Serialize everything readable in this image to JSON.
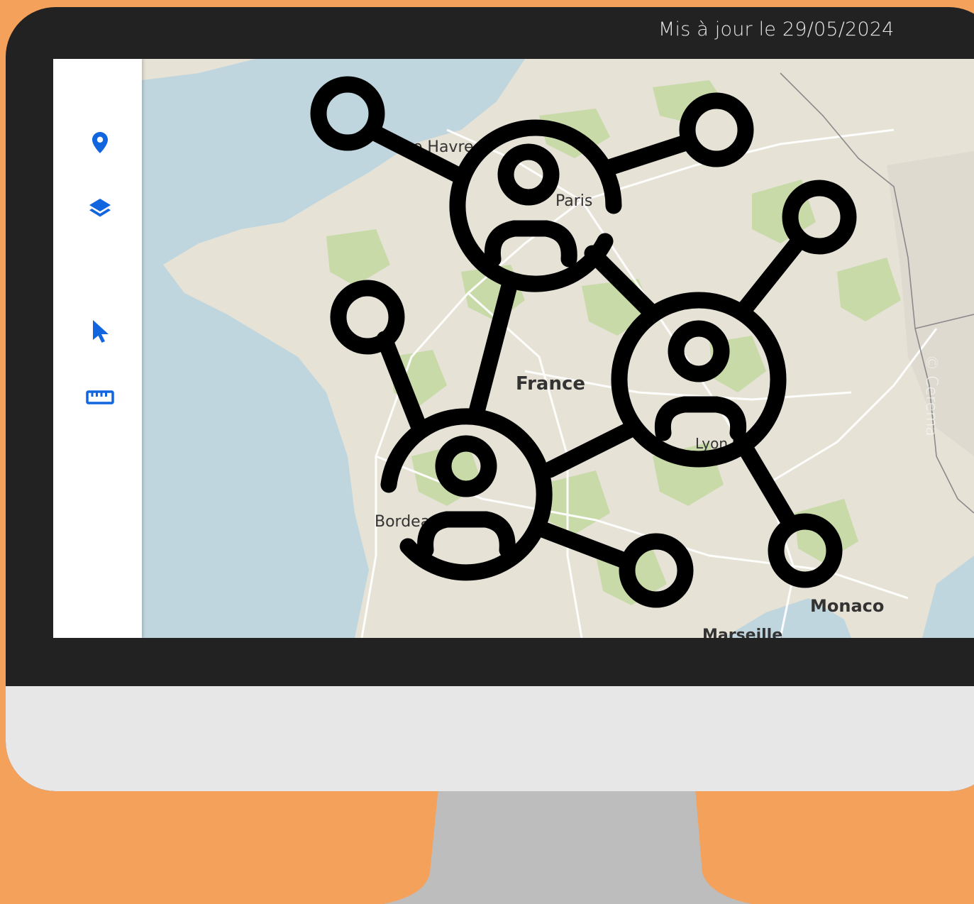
{
  "header": {
    "updated": "Mis à jour le 29/05/2024"
  },
  "toolbar": {
    "items": [
      {
        "name": "location-pin-icon",
        "color": "#1166E0"
      },
      {
        "name": "layers-icon",
        "color": "#1166E0"
      },
      {
        "name": "cursor-arrow-icon",
        "color": "#1166E0"
      },
      {
        "name": "ruler-icon",
        "color": "#1166E0"
      }
    ]
  },
  "map": {
    "labels": {
      "le_havre": "Le Havre",
      "paris": "Paris",
      "france": "France",
      "bordeaux": "Bordeaux",
      "monaco": "Monaco",
      "marseille": "Marseille",
      "lyon": "Lyon"
    },
    "credit": "© Cerema",
    "colors": {
      "sea": "#C0D6DF",
      "land": "#E6E2D6",
      "forest": "#C8DAA8",
      "road": "#ffffff",
      "border": "#8a8a8a"
    }
  },
  "overlay": {
    "icon": "network-people-icon",
    "color": "#000000"
  },
  "colors": {
    "background": "#F4A15B",
    "frame": "#222222",
    "chin": "#E7E7E7",
    "stand": "#BDBDBD"
  }
}
